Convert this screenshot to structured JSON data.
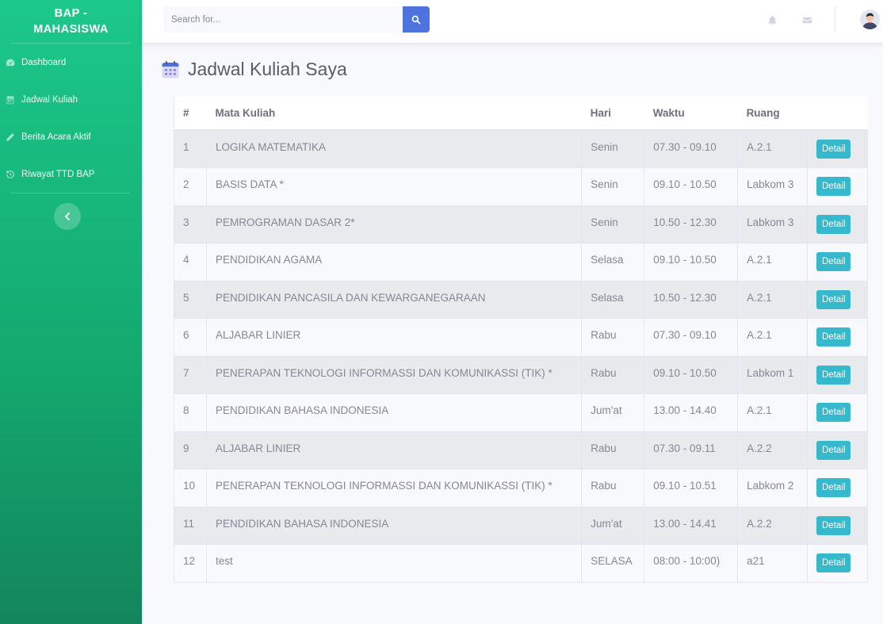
{
  "sidebar": {
    "brand_line1": "BAP -",
    "brand_line2": "MAHASISWA",
    "items": [
      {
        "label": "Dashboard",
        "icon": "dashboard-icon"
      },
      {
        "label": "Jadwal Kuliah",
        "icon": "calendar-icon"
      },
      {
        "label": "Berita Acara Aktif",
        "icon": "pencil-icon"
      },
      {
        "label": "Riwayat TTD BAP",
        "icon": "history-icon"
      }
    ],
    "toggle_icon": "chevron-left-icon"
  },
  "topbar": {
    "search_placeholder": "Search for...",
    "icons": [
      "search-icon",
      "bell-icon",
      "envelope-icon",
      "avatar"
    ]
  },
  "page": {
    "title": "Jadwal Kuliah Saya",
    "title_icon": "calendar-icon"
  },
  "table": {
    "headers": [
      "#",
      "Mata Kuliah",
      "Hari",
      "Waktu",
      "Ruang",
      ""
    ],
    "button_label": "Detail",
    "rows": [
      {
        "no": "1",
        "mk": "LOGIKA MATEMATIKA",
        "hari": "Senin",
        "waktu": "07.30 - 09.10",
        "ruang": "A.2.1"
      },
      {
        "no": "2",
        "mk": "BASIS DATA *",
        "hari": "Senin",
        "waktu": "09.10 - 10.50",
        "ruang": "Labkom 3"
      },
      {
        "no": "3",
        "mk": "PEMROGRAMAN DASAR 2*",
        "hari": "Senin",
        "waktu": "10.50 - 12.30",
        "ruang": "Labkom 3"
      },
      {
        "no": "4",
        "mk": "PENDIDIKAN AGAMA",
        "hari": "Selasa",
        "waktu": "09.10 - 10.50",
        "ruang": "A.2.1"
      },
      {
        "no": "5",
        "mk": "PENDIDIKAN PANCASILA DAN KEWARGANEGARAAN",
        "hari": "Selasa",
        "waktu": "10.50 - 12.30",
        "ruang": "A.2.1"
      },
      {
        "no": "6",
        "mk": "ALJABAR LINIER",
        "hari": "Rabu",
        "waktu": "07.30 - 09.10",
        "ruang": "A.2.1"
      },
      {
        "no": "7",
        "mk": "PENERAPAN TEKNOLOGI INFORMASSI DAN KOMUNIKASSI (TIK) *",
        "hari": "Rabu",
        "waktu": "09.10 - 10.50",
        "ruang": "Labkom 1"
      },
      {
        "no": "8",
        "mk": "PENDIDIKAN BAHASA INDONESIA",
        "hari": "Jum'at",
        "waktu": "13.00 - 14.40",
        "ruang": "A.2.1"
      },
      {
        "no": "9",
        "mk": "ALJABAR LINIER",
        "hari": "Rabu",
        "waktu": "07.30 - 09.11",
        "ruang": "A.2.2"
      },
      {
        "no": "10",
        "mk": "PENERAPAN TEKNOLOGI INFORMASSI DAN KOMUNIKASSI (TIK) *",
        "hari": "Rabu",
        "waktu": "09.10 - 10.51",
        "ruang": "Labkom 2"
      },
      {
        "no": "11",
        "mk": "PENDIDIKAN BAHASA INDONESIA",
        "hari": "Jum'at",
        "waktu": "13.00 - 14.41",
        "ruang": "A.2.2"
      },
      {
        "no": "12",
        "mk": "test",
        "hari": "SELASA",
        "waktu": "08:00 - 10:00)",
        "ruang": "a21"
      }
    ]
  },
  "colors": {
    "sidebar_top": "#1cc88a",
    "sidebar_bottom": "#13855c",
    "primary": "#4e73df",
    "info": "#36b9cc"
  }
}
